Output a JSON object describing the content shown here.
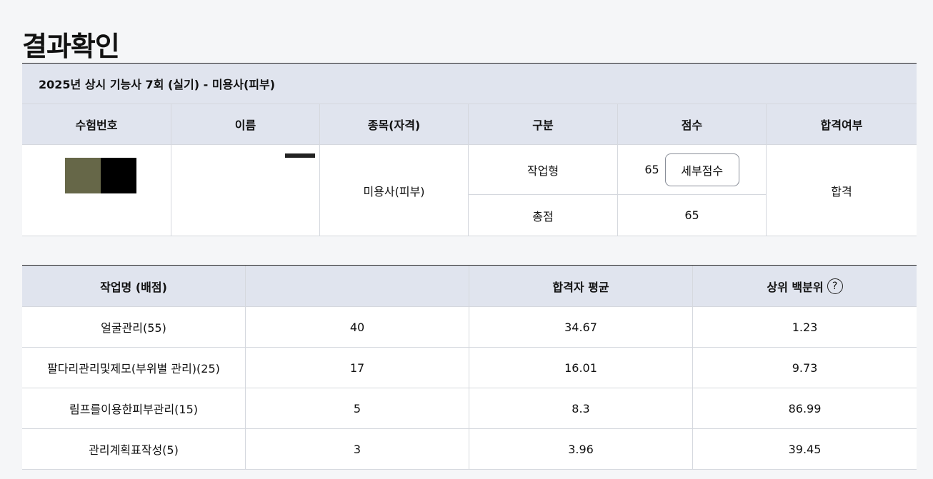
{
  "page": {
    "title": "결과확인"
  },
  "exam": {
    "title": "2025년 상시 기능사 7회 (실기) - 미용사(피부)"
  },
  "result": {
    "headers": [
      "수험번호",
      "이름",
      "종목(자격)",
      "구분",
      "점수",
      "합격여부"
    ],
    "subject": "미용사(피부)",
    "categories": [
      "작업형",
      "총점"
    ],
    "scores": [
      "65",
      "65"
    ],
    "detail_button_label": "세부점수",
    "pass_status": "합격"
  },
  "tasks": {
    "headers": [
      "작업명 (배점)",
      "",
      "합격자 평균",
      "상위 백분위"
    ],
    "help_icon_glyph": "?",
    "rows": [
      {
        "name": "얼굴관리(55)",
        "score": "40",
        "avg": "34.67",
        "percentile": "1.23"
      },
      {
        "name": "팔다리관리및제모(부위별 관리)(25)",
        "score": "17",
        "avg": "16.01",
        "percentile": "9.73"
      },
      {
        "name": "림프를이용한피부관리(15)",
        "score": "5",
        "avg": "8.3",
        "percentile": "86.99"
      },
      {
        "name": "관리계획표작성(5)",
        "score": "3",
        "avg": "3.96",
        "percentile": "39.45"
      }
    ]
  },
  "colors": {
    "header_bg": "#e0e4ee",
    "redact_1": "#666748",
    "redact_2": "#000000"
  }
}
